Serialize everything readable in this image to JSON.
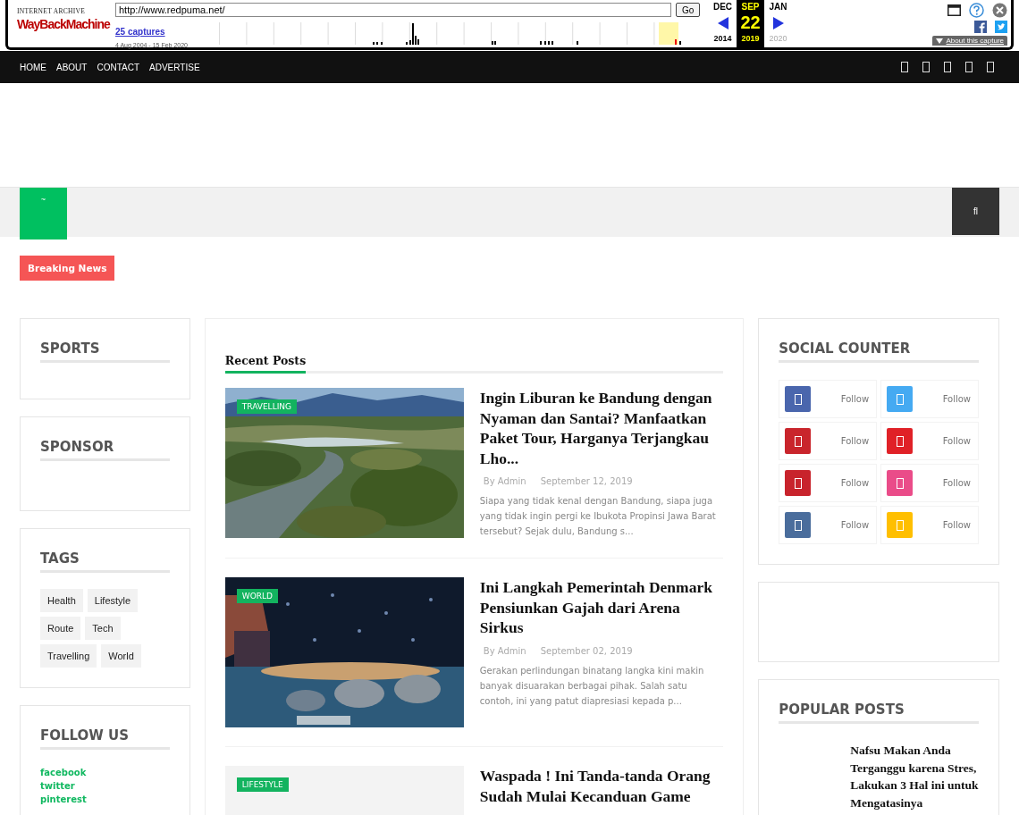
{
  "wayback": {
    "logo_top": "INTERNET ARCHIVE",
    "logo": "WayBackMachine",
    "url": "http://www.redpuma.net/",
    "go": "Go",
    "captures": "25 captures",
    "range": "4 Aug 2004 - 15 Feb 2020",
    "months": [
      {
        "month": "DEC",
        "year": "2014",
        "selected": false,
        "disabled": false
      },
      {
        "month": "SEP",
        "day": "22",
        "year": "2019",
        "selected": true,
        "disabled": false
      },
      {
        "month": "JAN",
        "year": "2020",
        "selected": false,
        "disabled": true
      }
    ],
    "about": "About this capture"
  },
  "nav": {
    "items": [
      "HOME",
      "ABOUT",
      "CONTACT",
      "ADVERTISE"
    ]
  },
  "header": {
    "menu_toggle": "~",
    "search": "fl"
  },
  "breaking": "Breaking News",
  "left_widgets": [
    {
      "kind": "empty",
      "title": "SPORTS"
    },
    {
      "kind": "empty",
      "title": "SPONSOR"
    },
    {
      "kind": "tags",
      "title": "TAGS",
      "tags": [
        "Health",
        "Lifestyle",
        "Route",
        "Tech",
        "Travelling",
        "World"
      ]
    },
    {
      "kind": "links",
      "title": "FOLLOW US",
      "links": [
        "facebook",
        "twitter",
        "pinterest"
      ]
    }
  ],
  "recent": {
    "title": "Recent Posts",
    "posts": [
      {
        "kind": "picture",
        "category": "TRAVELLING",
        "title": "Ingin Liburan ke Bandung dengan Nyaman dan Santai? Manfaatkan Paket Tour, Harganya Terjangkau Lho...",
        "author": "By Admin",
        "date": "September 12, 2019",
        "excerpt": "Siapa yang tidak kenal dengan Bandung, siapa juga yang tidak ingin pergi ke Ibukota Propinsi Jawa Barat tersebut? Sejak dulu, Bandung s..."
      },
      {
        "kind": "picture",
        "category": "WORLD",
        "title": "Ini Langkah Pemerintah Denmark Pensiunkan Gajah dari Arena Sirkus",
        "author": "By Admin",
        "date": "September 02, 2019",
        "excerpt": "Gerakan perlindungan binatang langka kini makin banyak disuarakan berbagai pihak. Salah satu contoh, ini yang patut diapresiasi kepada p..."
      },
      {
        "kind": "placeholder",
        "category": "LIFESTYLE",
        "title": "Waspada ! Ini Tanda-tanda Orang Sudah Mulai Kecanduan Game"
      }
    ]
  },
  "social_counter": {
    "title": "SOCIAL COUNTER",
    "items": [
      {
        "color": "#4a66ad",
        "label": "Follow"
      },
      {
        "color": "#45aaf2",
        "label": "Follow"
      },
      {
        "color": "#c9252c",
        "label": "Follow"
      },
      {
        "color": "#e02127",
        "label": "Follow"
      },
      {
        "color": "#c8232c",
        "label": "Follow"
      },
      {
        "color": "#ea4c89",
        "label": "Follow"
      },
      {
        "color": "#4a6d9c",
        "label": "Follow"
      },
      {
        "color": "#ffbf00",
        "label": "Follow"
      }
    ]
  },
  "popular": {
    "title": "POPULAR POSTS",
    "posts": [
      "Nafsu Makan Anda Terganggu karena Stres, Lakukan 3 Hal ini untuk Mengatasinya"
    ]
  }
}
